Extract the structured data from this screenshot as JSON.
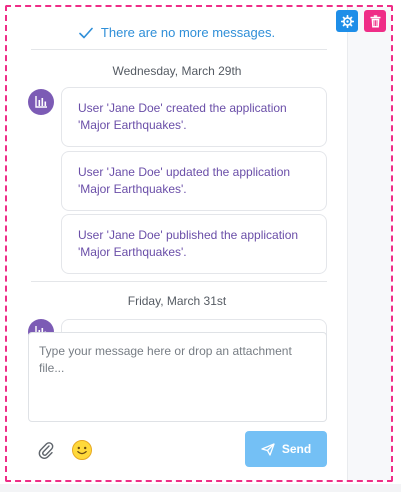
{
  "status": {
    "no_more_messages": "There are no more messages."
  },
  "groups": [
    {
      "date": "Wednesday, March 29th",
      "messages": [
        "User 'Jane Doe' created the application 'Major Earthquakes'.",
        "User 'Jane Doe' updated the application 'Major Earthquakes'.",
        "User 'Jane Doe' published the application 'Major Earthquakes'."
      ]
    },
    {
      "date": "Friday, March 31st",
      "messages": [
        ""
      ]
    }
  ],
  "composer": {
    "placeholder": "Type your message here or drop an attachment file..."
  },
  "actions": {
    "send_label": "Send"
  },
  "icons": {
    "settings": "gear-icon",
    "delete": "trash-icon",
    "status": "check-icon",
    "avatar": "bar-chart-icon",
    "attach": "paperclip-icon",
    "emoji": "smiley-icon",
    "send": "paper-plane-icon"
  },
  "colors": {
    "accent_pink": "#ef2d87",
    "accent_blue": "#1e8ee8",
    "avatar_purple": "#7c5bb5",
    "message_text": "#6a4ea8",
    "send_button": "#74c0f5"
  }
}
